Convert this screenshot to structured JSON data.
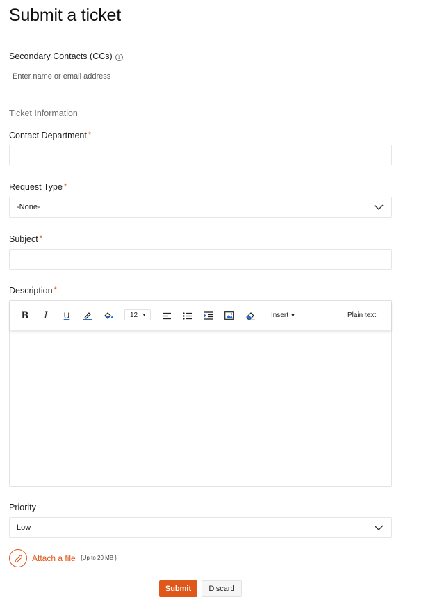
{
  "page": {
    "title": "Submit a ticket"
  },
  "cc": {
    "label": "Secondary Contacts (CCs)",
    "info_icon": "info-icon",
    "placeholder": "Enter name or email address",
    "value": ""
  },
  "section": {
    "ticket_info": "Ticket Information"
  },
  "fields": {
    "department": {
      "label": "Contact Department",
      "required_mark": "*",
      "value": ""
    },
    "request_type": {
      "label": "Request Type",
      "required_mark": "*",
      "value": "-None-"
    },
    "subject": {
      "label": "Subject",
      "required_mark": "*",
      "value": ""
    },
    "description": {
      "label": "Description",
      "required_mark": "*",
      "value": ""
    },
    "priority": {
      "label": "Priority",
      "value": "Low"
    }
  },
  "toolbar": {
    "bold": "B",
    "italic": "I",
    "underline": "U",
    "font_size": "12",
    "insert": "Insert",
    "plain_text": "Plain text",
    "icons": [
      "bold-icon",
      "italic-icon",
      "underline-icon",
      "text-color-icon",
      "background-color-icon",
      "font-size-dropdown",
      "align-left-icon",
      "bulleted-list-icon",
      "indent-icon",
      "insert-image-icon",
      "clear-format-icon",
      "insert-dropdown",
      "plain-text-toggle"
    ]
  },
  "attach": {
    "label": "Attach a file",
    "hint": "{Up to 20 MB }",
    "icon": "paperclip-icon"
  },
  "actions": {
    "submit": "Submit",
    "discard": "Discard"
  },
  "colors": {
    "accent": "#e0571a",
    "required": "#e0571a",
    "link_blue": "#1e6fd9"
  }
}
